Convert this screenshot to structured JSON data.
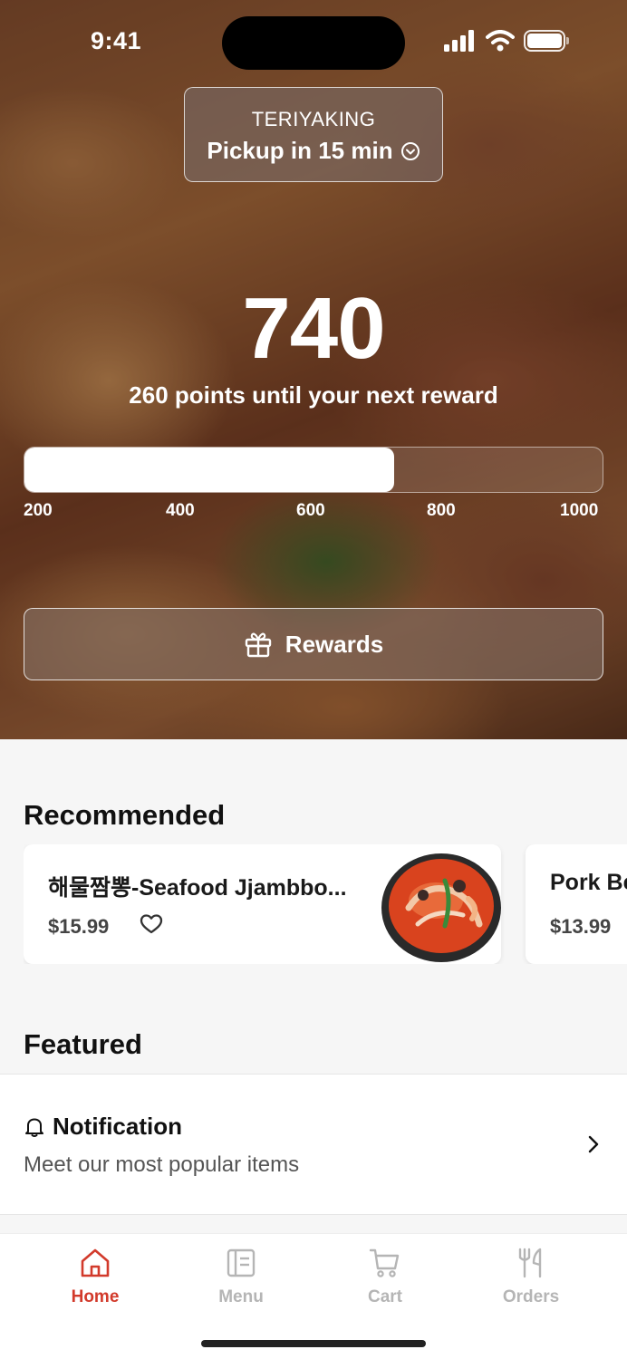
{
  "status": {
    "time": "9:41"
  },
  "store": {
    "name": "TERIYAKING",
    "pickup": "Pickup in 15 min"
  },
  "rewards": {
    "points": "740",
    "subtitle": "260 points until your next reward",
    "progress_fraction": 0.64,
    "ticks": [
      "200",
      "400",
      "600",
      "800",
      "1000"
    ],
    "button_label": "Rewards"
  },
  "recommended": {
    "title": "Recommended",
    "items": [
      {
        "name": "해물짬뽕-Seafood Jjambbo...",
        "price": "$15.99"
      },
      {
        "name": "Pork Be",
        "price": "$13.99"
      }
    ]
  },
  "featured": {
    "title": "Featured",
    "item": {
      "title": "Notification",
      "subtitle": "Meet our most popular items"
    }
  },
  "tabs": [
    {
      "label": "Home",
      "icon": "home-icon",
      "active": true
    },
    {
      "label": "Menu",
      "icon": "menu-icon",
      "active": false
    },
    {
      "label": "Cart",
      "icon": "cart-icon",
      "active": false
    },
    {
      "label": "Orders",
      "icon": "orders-icon",
      "active": false
    }
  ],
  "colors": {
    "accent": "#d23a2b",
    "tab_inactive": "#b5b5b5"
  }
}
